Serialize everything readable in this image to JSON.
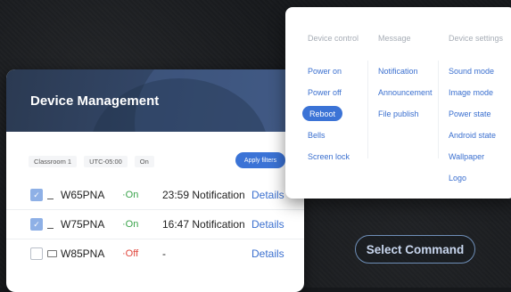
{
  "device_management": {
    "title": "Device Management",
    "filters": [
      "Classroom 1",
      "UTC-05:00",
      "On"
    ],
    "apply_label": "Apply filters",
    "rows": [
      {
        "checked": true,
        "icon": "dash",
        "name": "W65PNA",
        "status": "On",
        "status_prefix": "·On",
        "notification": "23:59 Notification",
        "action": "Details"
      },
      {
        "checked": true,
        "icon": "dash",
        "name": "W75PNA",
        "status": "On",
        "status_prefix": "·On",
        "notification": "16:47 Notification",
        "action": "Details"
      },
      {
        "checked": false,
        "icon": "monitor",
        "name": "W85PNA",
        "status": "Off",
        "status_prefix": "·Off",
        "notification": "-",
        "action": "Details"
      }
    ]
  },
  "command_menu": {
    "columns": [
      {
        "header": "Device control",
        "items": [
          "Power on",
          "Power off",
          "Reboot",
          "Bells",
          "Screen lock"
        ],
        "active_index": 2
      },
      {
        "header": "Message",
        "items": [
          "Notification",
          "Announcement",
          "File publish"
        ]
      },
      {
        "header": "Device settings",
        "items": [
          "Sound mode",
          "Image mode",
          "Power state",
          "Android state",
          "Wallpaper",
          "Logo"
        ]
      }
    ]
  },
  "select_command_label": "Select Command",
  "colors": {
    "accent": "#3b73d6",
    "on": "#39a34a",
    "off": "#e0453b",
    "link": "#3a6fcf",
    "header_bg": "#2b3a52"
  }
}
